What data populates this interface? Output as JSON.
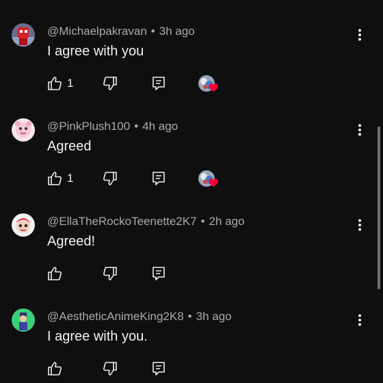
{
  "comments": [
    {
      "author": "@Michaelpakravan",
      "time": "3h ago",
      "text": "I agree with you",
      "likes": "1",
      "creator_hearted": true,
      "avatar": "red-robot-avatar"
    },
    {
      "author": "@PinkPlush100",
      "time": "4h ago",
      "text": "Agreed",
      "likes": "1",
      "creator_hearted": true,
      "avatar": "pink-plush-avatar"
    },
    {
      "author": "@EllaTheRockoTeenette2K7",
      "time": "2h ago",
      "text": "Agreed!",
      "likes": "",
      "creator_hearted": false,
      "avatar": "cartoon-girl-avatar"
    },
    {
      "author": "@AestheticAnimeKing2K8",
      "time": "3h ago",
      "text": "I agree with you.",
      "likes": "",
      "creator_hearted": false,
      "avatar": "green-anime-avatar"
    }
  ],
  "separator": "•",
  "colors": {
    "background": "#0f0f0f",
    "text": "#f1f1f1",
    "meta_text": "#aaaaaa",
    "heart": "#ff0033",
    "scrollbar": "#717171"
  },
  "icons": {
    "like": "thumbs-up-icon",
    "dislike": "thumbs-down-icon",
    "reply": "reply-icon",
    "more": "more-vert-icon",
    "heart": "heart-icon"
  }
}
